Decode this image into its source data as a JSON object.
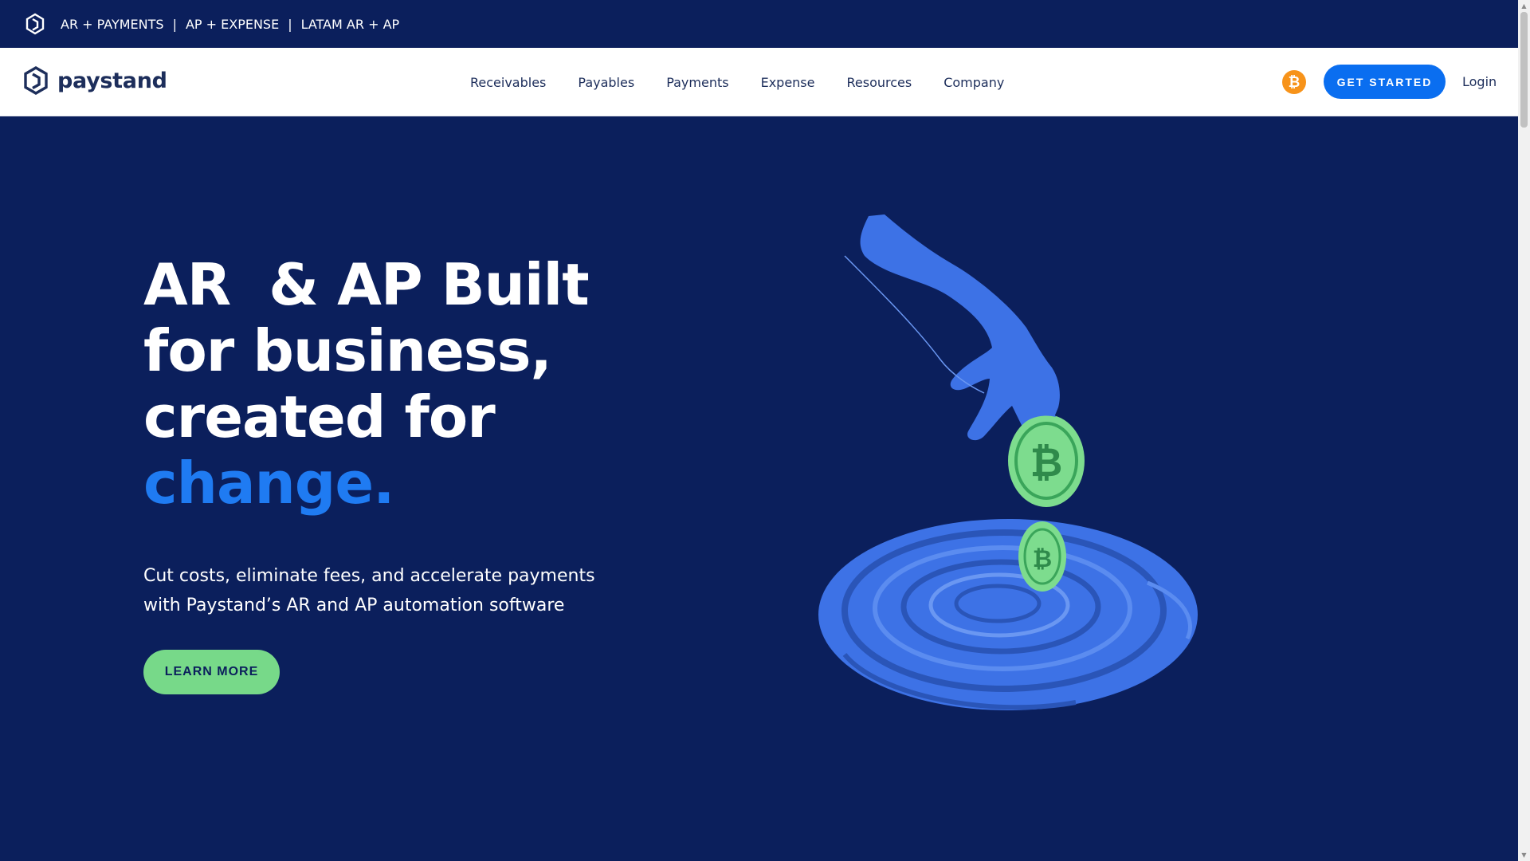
{
  "topbar": {
    "links": [
      "AR + PAYMENTS",
      "AP + EXPENSE",
      "LATAM AR + AP"
    ],
    "separator": "|"
  },
  "navbar": {
    "brand": "paystand",
    "menu": [
      "Receivables",
      "Payables",
      "Payments",
      "Expense",
      "Resources",
      "Company"
    ],
    "crypto_icon": "bitcoin-icon",
    "cta_label": "GET STARTED",
    "login_label": "Login"
  },
  "hero": {
    "headline_line1": "AR  & AP Built",
    "headline_line2": "for business,",
    "headline_line3": "created for",
    "headline_accent": "change.",
    "subcopy": "Cut costs, eliminate fees, and accelerate payments with Paystand’s AR and AP automation software",
    "button_label": "LEARN MORE",
    "illustration": "hand-dropping-bitcoin-into-water"
  },
  "colors": {
    "navy": "#0b1f5c",
    "accent_blue": "#1f7bf2",
    "cta_blue": "#0a6ef0",
    "green": "#77d989",
    "bitcoin_orange": "#f7931a"
  }
}
